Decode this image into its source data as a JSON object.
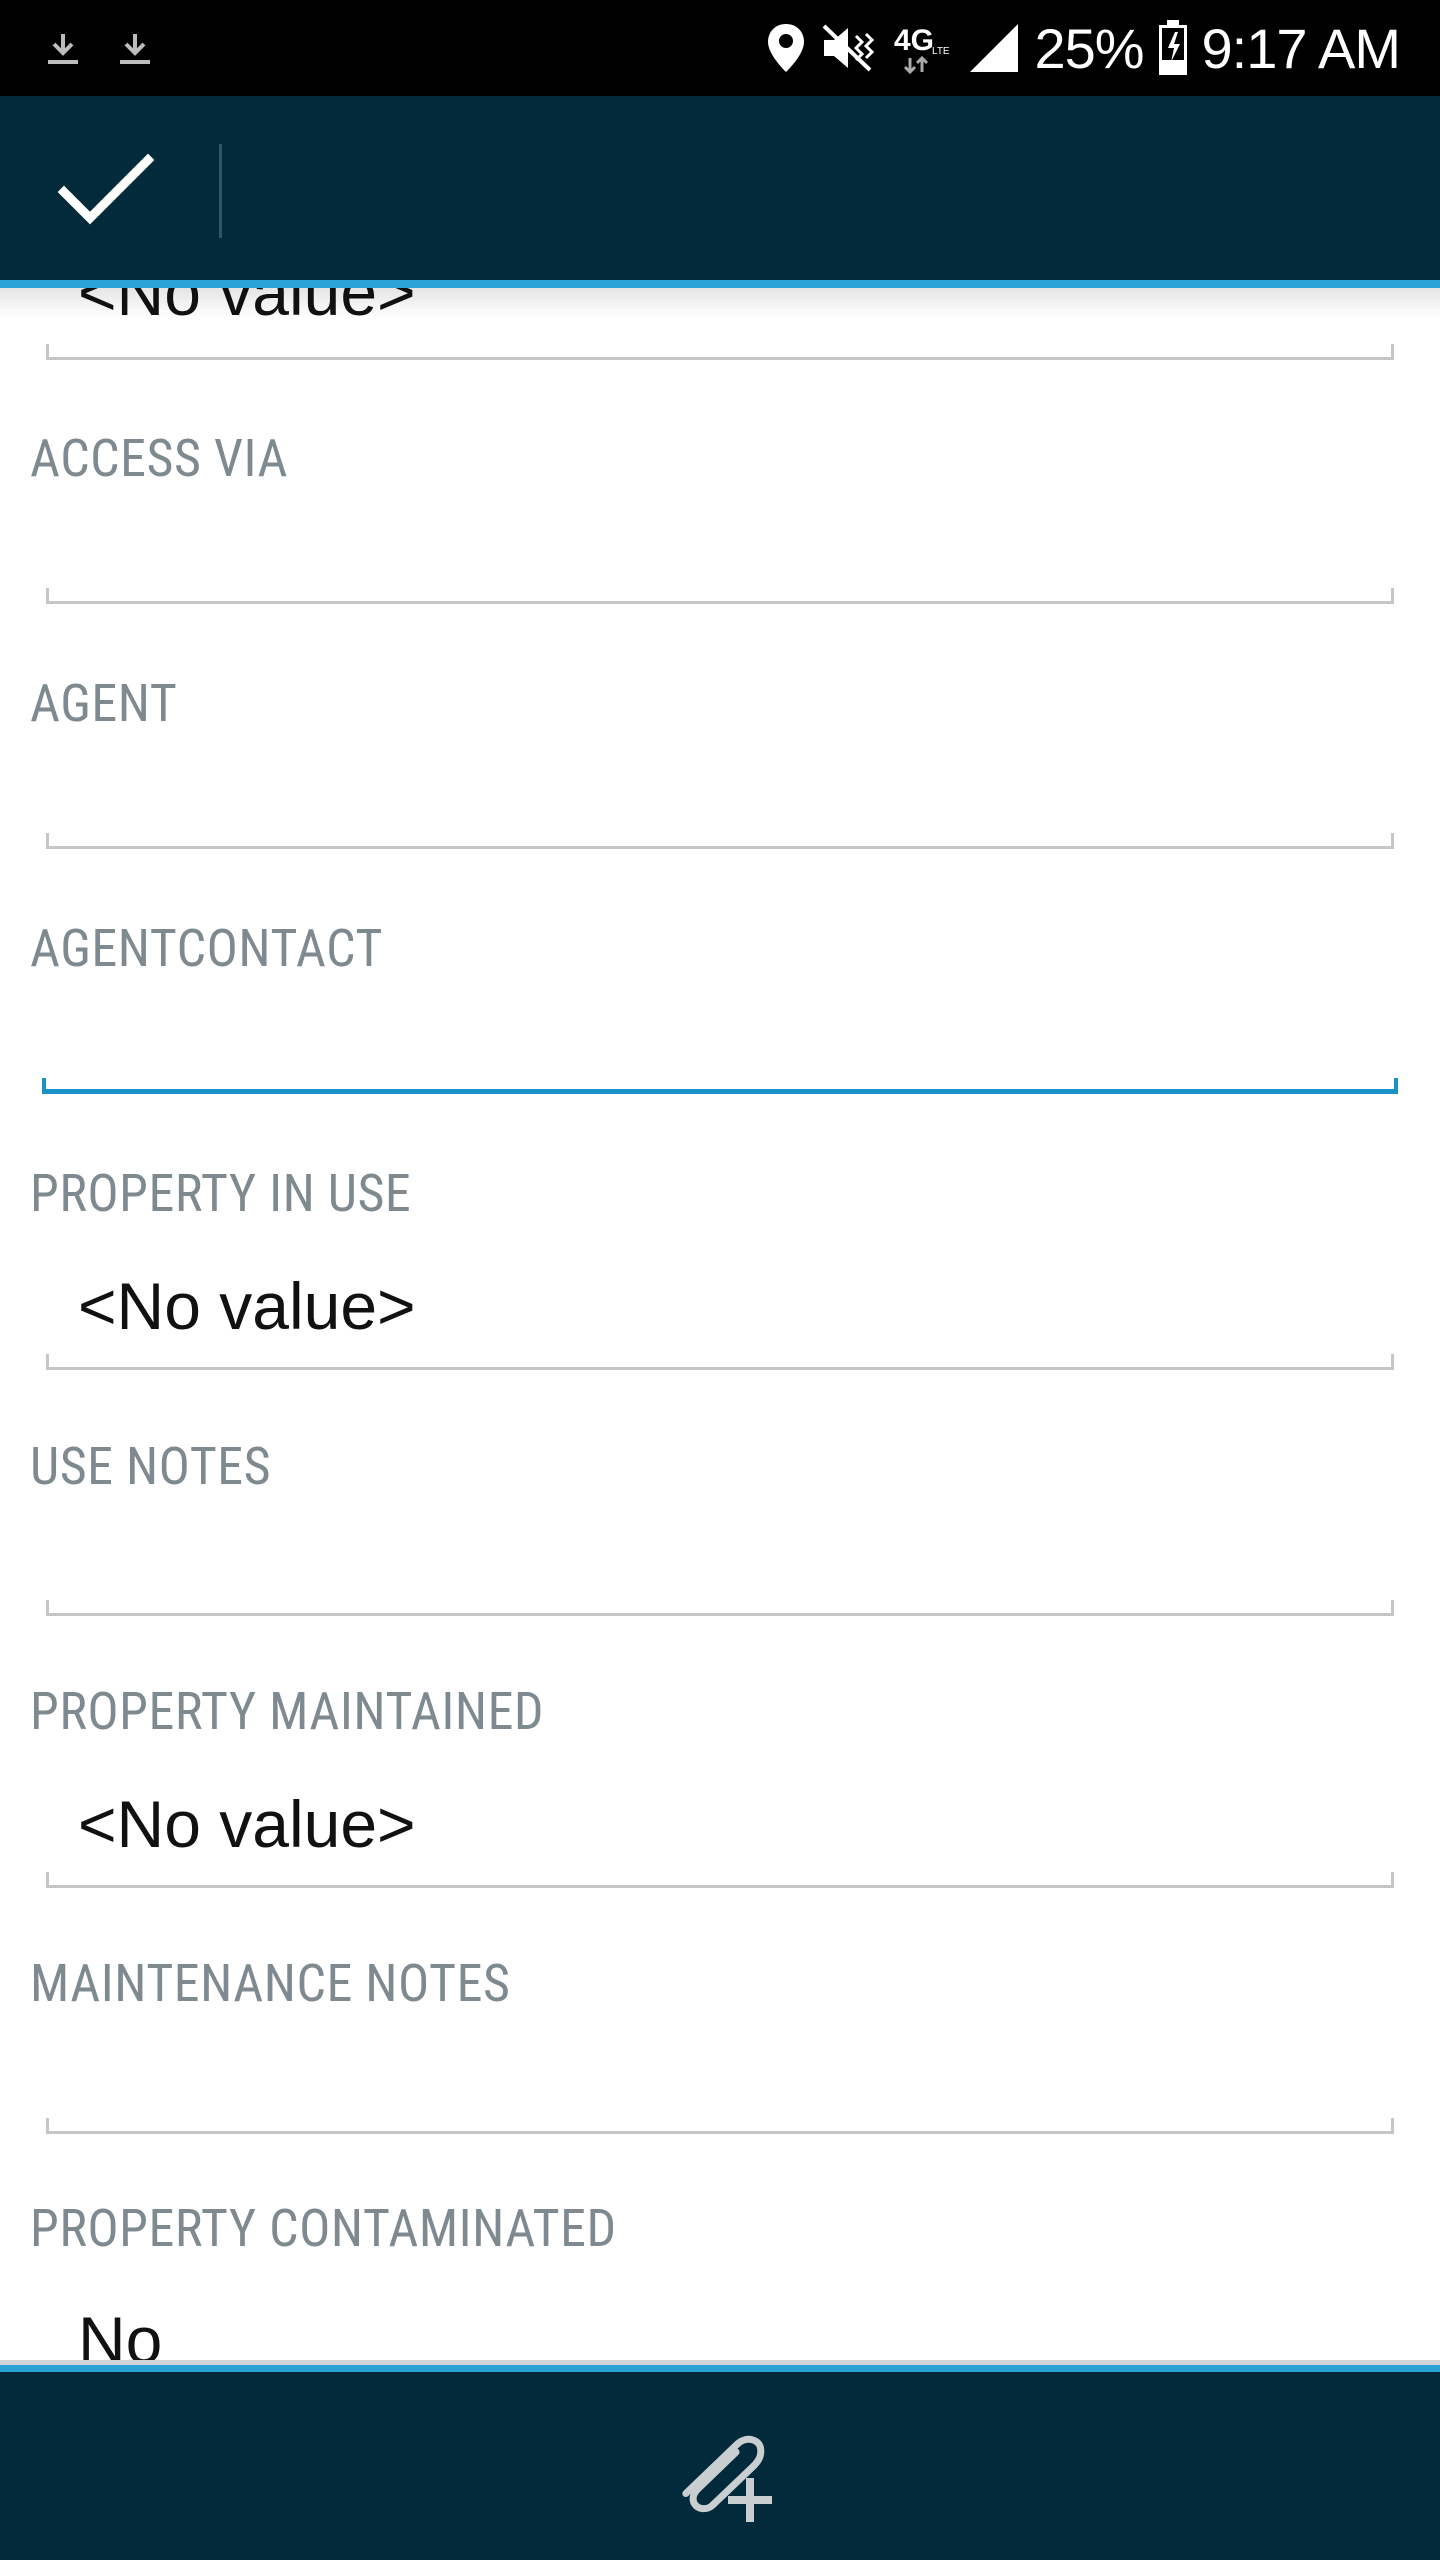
{
  "status_bar": {
    "network": "4G",
    "battery": "25%",
    "time": "9:17 AM",
    "icons": [
      "download-icon",
      "download-icon",
      "location-icon",
      "vibrate-icon",
      "lte-icon",
      "signal-icon",
      "battery-icon"
    ]
  },
  "toolbar": {
    "confirm_icon": "check-icon"
  },
  "form": {
    "top_partial_value": "<No value>",
    "access_via": {
      "label": "ACCESS VIA",
      "value": ""
    },
    "agent": {
      "label": "AGENT",
      "value": ""
    },
    "agentcontact": {
      "label": "AGENTCONTACT",
      "value": ""
    },
    "property_in_use": {
      "label": "PROPERTY IN USE",
      "value": "<No value>"
    },
    "use_notes": {
      "label": "USE NOTES",
      "value": ""
    },
    "property_maintained": {
      "label": "PROPERTY MAINTAINED",
      "value": "<No value>"
    },
    "maintenance_notes": {
      "label": "MAINTENANCE NOTES",
      "value": ""
    },
    "property_contaminated": {
      "label": "PROPERTY CONTAMINATED",
      "value": "No"
    }
  },
  "bottom_bar": {
    "attach_icon": "attachment-add-icon"
  },
  "colors": {
    "toolbar_bg": "#022a3a",
    "accent": "#2aa2d6",
    "label_text": "#7e8a90",
    "field_line": "#c6c6c6",
    "active_field_line": "#1a92c7"
  }
}
